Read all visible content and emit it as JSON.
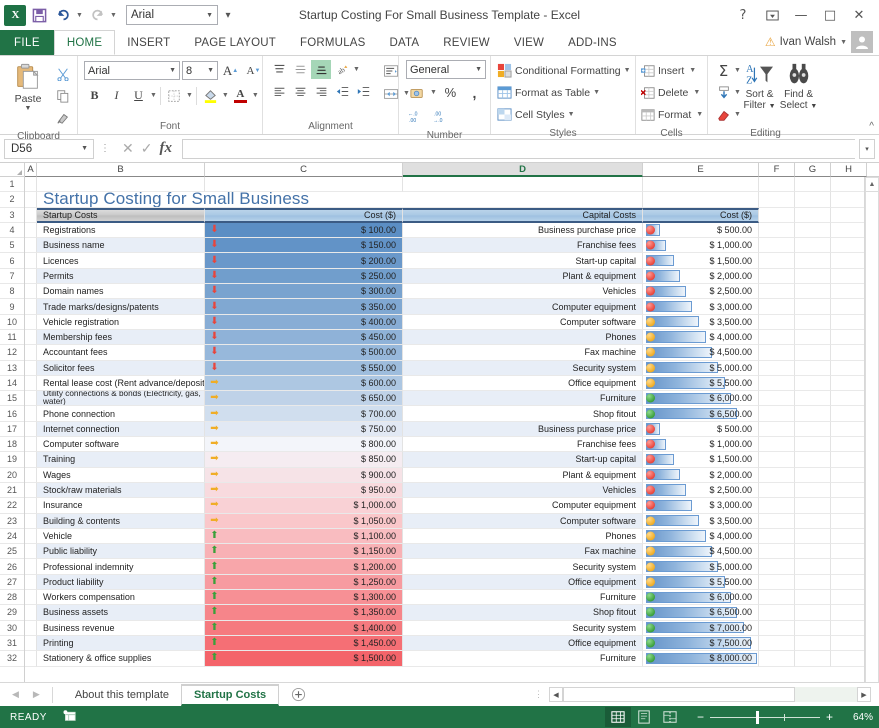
{
  "window": {
    "title": "Startup Costing For Small Business Template - Excel",
    "help_icon": "?",
    "ribbon_display_icon": "ribbon-options",
    "minimize_icon": "—",
    "maximize_icon": "□",
    "close_icon": "✕"
  },
  "quick_access": {
    "app_icon": "excel-logo",
    "save_label": "save-icon",
    "undo_label": "undo-icon",
    "redo_label": "redo-icon",
    "font_name": "Arial",
    "more_label": "more-commands"
  },
  "account": {
    "warning_icon": "warning-triangle",
    "user_name": "Ivan Walsh",
    "avatar_icon": "user-avatar"
  },
  "tabs": {
    "file": "FILE",
    "items": [
      {
        "label": "HOME",
        "active": true
      },
      {
        "label": "INSERT",
        "active": false
      },
      {
        "label": "PAGE LAYOUT",
        "active": false
      },
      {
        "label": "FORMULAS",
        "active": false
      },
      {
        "label": "DATA",
        "active": false
      },
      {
        "label": "REVIEW",
        "active": false
      },
      {
        "label": "VIEW",
        "active": false
      },
      {
        "label": "ADD-INS",
        "active": false
      }
    ]
  },
  "ribbon": {
    "clipboard": {
      "group_label": "Clipboard",
      "paste_label": "Paste",
      "cut_label": "cut-icon",
      "copy_label": "copy-icon",
      "format_painter_label": "format-painter-icon",
      "dialog_launcher": "▪"
    },
    "font": {
      "group_label": "Font",
      "font_name": "Arial",
      "font_size": "8",
      "grow_font": "A",
      "shrink_font": "A",
      "bold": "B",
      "italic": "I",
      "underline": "U",
      "borders": "borders-icon",
      "fill_color": "fill-color-icon",
      "font_color": "A",
      "dialog_launcher": "▪"
    },
    "alignment": {
      "group_label": "Alignment",
      "top_align": "top-align-icon",
      "middle_align": "middle-align-icon",
      "bottom_align": "bottom-align-icon",
      "orientation": "orientation-icon",
      "align_left": "align-left-icon",
      "align_center": "align-center-icon",
      "align_right": "align-right-icon",
      "decrease_indent": "decrease-indent-icon",
      "increase_indent": "increase-indent-icon",
      "wrap_text": "wrap-text-icon",
      "merge_center": "merge-center-icon",
      "dialog_launcher": "▪"
    },
    "number": {
      "group_label": "Number",
      "format": "General",
      "accounting": "accounting-format-icon",
      "percent": "%",
      "comma": ",",
      "increase_decimal": ".00",
      "decrease_decimal": ".00",
      "dialog_launcher": "▪"
    },
    "styles": {
      "group_label": "Styles",
      "conditional_formatting": "Conditional Formatting",
      "format_as_table": "Format as Table",
      "cell_styles": "Cell Styles"
    },
    "cells": {
      "group_label": "Cells",
      "insert": "Insert",
      "delete": "Delete",
      "format": "Format"
    },
    "editing": {
      "group_label": "Editing",
      "autosum": "Σ",
      "fill": "fill-icon",
      "clear": "clear-icon",
      "sort_filter": "Sort &\nFilter",
      "sort_filter_l1": "Sort &",
      "sort_filter_l2": "Filter",
      "find_select_l1": "Find &",
      "find_select_l2": "Select"
    },
    "collapse_icon": "^"
  },
  "formula_bar": {
    "name_box": "D56",
    "cancel_icon": "✕",
    "enter_icon": "✓",
    "function_icon": "fx",
    "formula_value": "",
    "expand_icon": "▾"
  },
  "grid": {
    "columns": [
      "A",
      "B",
      "C",
      "D",
      "E",
      "F",
      "G",
      "H"
    ],
    "selected_column": "D",
    "row_numbers": [
      1,
      2,
      3,
      4,
      5,
      6,
      7,
      8,
      9,
      10,
      11,
      12,
      13,
      14,
      15,
      16,
      17,
      18,
      19,
      20,
      21,
      22,
      23,
      24,
      25,
      26,
      27,
      28,
      29,
      30,
      31,
      32
    ],
    "sheet_title": "Startup Costing for Small Business",
    "headers": {
      "startup_costs": "Startup Costs",
      "cost_left": "Cost ($)",
      "capital_costs": "Capital Costs",
      "cost_right": "Cost ($)"
    }
  },
  "chart_data": {
    "type": "table",
    "title": "Startup Costing for Small Business",
    "startup_costs": {
      "columns": [
        "Startup Costs",
        "Cost ($)"
      ],
      "rows": [
        {
          "row": 4,
          "label": "Registrations",
          "value": "$ 100.00",
          "amount": 100,
          "icon": "red-down-arrow"
        },
        {
          "row": 5,
          "label": "Business name",
          "value": "$ 150.00",
          "amount": 150,
          "icon": "red-down-arrow"
        },
        {
          "row": 6,
          "label": "Licences",
          "value": "$ 200.00",
          "amount": 200,
          "icon": "red-down-arrow"
        },
        {
          "row": 7,
          "label": "Permits",
          "value": "$ 250.00",
          "amount": 250,
          "icon": "red-down-arrow"
        },
        {
          "row": 8,
          "label": "Domain names",
          "value": "$ 300.00",
          "amount": 300,
          "icon": "red-down-arrow"
        },
        {
          "row": 9,
          "label": "Trade marks/designs/patents",
          "value": "$ 350.00",
          "amount": 350,
          "icon": "red-down-arrow"
        },
        {
          "row": 10,
          "label": "Vehicle registration",
          "value": "$ 400.00",
          "amount": 400,
          "icon": "red-down-arrow"
        },
        {
          "row": 11,
          "label": "Membership fees",
          "value": "$ 450.00",
          "amount": 450,
          "icon": "red-down-arrow"
        },
        {
          "row": 12,
          "label": "Accountant fees",
          "value": "$ 500.00",
          "amount": 500,
          "icon": "red-down-arrow"
        },
        {
          "row": 13,
          "label": "Solicitor fees",
          "value": "$ 550.00",
          "amount": 550,
          "icon": "red-down-arrow"
        },
        {
          "row": 14,
          "label": "Rental lease cost (Rent advance/deposit)",
          "value": "$ 600.00",
          "amount": 600,
          "icon": "yellow-right-arrow"
        },
        {
          "row": 15,
          "label": "Utility connections & bonds (Electricity, gas, water)",
          "value": "$ 650.00",
          "amount": 650,
          "icon": "yellow-right-arrow"
        },
        {
          "row": 16,
          "label": "Phone connection",
          "value": "$ 700.00",
          "amount": 700,
          "icon": "yellow-right-arrow"
        },
        {
          "row": 17,
          "label": "Internet connection",
          "value": "$ 750.00",
          "amount": 750,
          "icon": "yellow-right-arrow"
        },
        {
          "row": 18,
          "label": "Computer software",
          "value": "$ 800.00",
          "amount": 800,
          "icon": "yellow-right-arrow"
        },
        {
          "row": 19,
          "label": "Training",
          "value": "$ 850.00",
          "amount": 850,
          "icon": "yellow-right-arrow"
        },
        {
          "row": 20,
          "label": "Wages",
          "value": "$ 900.00",
          "amount": 900,
          "icon": "yellow-right-arrow"
        },
        {
          "row": 21,
          "label": "Stock/raw materials",
          "value": "$ 950.00",
          "amount": 950,
          "icon": "yellow-right-arrow"
        },
        {
          "row": 22,
          "label": "Insurance",
          "value": "$ 1,000.00",
          "amount": 1000,
          "icon": "yellow-right-arrow"
        },
        {
          "row": 23,
          "label": "Building & contents",
          "value": "$ 1,050.00",
          "amount": 1050,
          "icon": "yellow-right-arrow"
        },
        {
          "row": 24,
          "label": "Vehicle",
          "value": "$ 1,100.00",
          "amount": 1100,
          "icon": "green-up-arrow"
        },
        {
          "row": 25,
          "label": "Public liability",
          "value": "$ 1,150.00",
          "amount": 1150,
          "icon": "green-up-arrow"
        },
        {
          "row": 26,
          "label": "Professional indemnity",
          "value": "$ 1,200.00",
          "amount": 1200,
          "icon": "green-up-arrow"
        },
        {
          "row": 27,
          "label": "Product liability",
          "value": "$ 1,250.00",
          "amount": 1250,
          "icon": "green-up-arrow"
        },
        {
          "row": 28,
          "label": "Workers compensation",
          "value": "$ 1,300.00",
          "amount": 1300,
          "icon": "green-up-arrow"
        },
        {
          "row": 29,
          "label": "Business assets",
          "value": "$ 1,350.00",
          "amount": 1350,
          "icon": "green-up-arrow"
        },
        {
          "row": 30,
          "label": "Business revenue",
          "value": "$ 1,400.00",
          "amount": 1400,
          "icon": "green-up-arrow"
        },
        {
          "row": 31,
          "label": "Printing",
          "value": "$ 1,450.00",
          "amount": 1450,
          "icon": "green-up-arrow"
        },
        {
          "row": 32,
          "label": "Stationery & office supplies",
          "value": "$ 1,500.00",
          "amount": 1500,
          "icon": "green-up-arrow"
        }
      ]
    },
    "capital_costs": {
      "columns": [
        "Capital Costs",
        "Cost ($)"
      ],
      "rows": [
        {
          "row": 4,
          "label": "Business purchase price",
          "value": "$ 500.00",
          "amount": 500,
          "icon": "red-circle",
          "bar_pct": 6
        },
        {
          "row": 5,
          "label": "Franchise fees",
          "value": "$ 1,000.00",
          "amount": 1000,
          "icon": "red-circle",
          "bar_pct": 12
        },
        {
          "row": 6,
          "label": "Start-up capital",
          "value": "$ 1,500.00",
          "amount": 1500,
          "icon": "red-circle",
          "bar_pct": 19
        },
        {
          "row": 7,
          "label": "Plant & equipment",
          "value": "$ 2,000.00",
          "amount": 2000,
          "icon": "red-circle",
          "bar_pct": 25
        },
        {
          "row": 8,
          "label": "Vehicles",
          "value": "$ 2,500.00",
          "amount": 2500,
          "icon": "red-circle",
          "bar_pct": 31
        },
        {
          "row": 9,
          "label": "Computer equipment",
          "value": "$ 3,000.00",
          "amount": 3000,
          "icon": "red-circle",
          "bar_pct": 37
        },
        {
          "row": 10,
          "label": "Computer software",
          "value": "$ 3,500.00",
          "amount": 3500,
          "icon": "yellow-circle",
          "bar_pct": 44
        },
        {
          "row": 11,
          "label": "Phones",
          "value": "$ 4,000.00",
          "amount": 4000,
          "icon": "yellow-circle",
          "bar_pct": 50
        },
        {
          "row": 12,
          "label": "Fax machine",
          "value": "$ 4,500.00",
          "amount": 4500,
          "icon": "yellow-circle",
          "bar_pct": 56
        },
        {
          "row": 13,
          "label": "Security system",
          "value": "$ 5,000.00",
          "amount": 5000,
          "icon": "yellow-circle",
          "bar_pct": 62
        },
        {
          "row": 14,
          "label": "Office equipment",
          "value": "$ 5,500.00",
          "amount": 5500,
          "icon": "yellow-circle",
          "bar_pct": 69
        },
        {
          "row": 15,
          "label": "Furniture",
          "value": "$ 6,000.00",
          "amount": 6000,
          "icon": "green-circle",
          "bar_pct": 75
        },
        {
          "row": 16,
          "label": "Shop fitout",
          "value": "$ 6,500.00",
          "amount": 6500,
          "icon": "green-circle",
          "bar_pct": 81
        },
        {
          "row": 17,
          "label": "Business purchase price",
          "value": "$ 500.00",
          "amount": 500,
          "icon": "red-circle",
          "bar_pct": 6
        },
        {
          "row": 18,
          "label": "Franchise fees",
          "value": "$ 1,000.00",
          "amount": 1000,
          "icon": "red-circle",
          "bar_pct": 12
        },
        {
          "row": 19,
          "label": "Start-up capital",
          "value": "$ 1,500.00",
          "amount": 1500,
          "icon": "red-circle",
          "bar_pct": 19
        },
        {
          "row": 20,
          "label": "Plant & equipment",
          "value": "$ 2,000.00",
          "amount": 2000,
          "icon": "red-circle",
          "bar_pct": 25
        },
        {
          "row": 21,
          "label": "Vehicles",
          "value": "$ 2,500.00",
          "amount": 2500,
          "icon": "red-circle",
          "bar_pct": 31
        },
        {
          "row": 22,
          "label": "Computer equipment",
          "value": "$ 3,000.00",
          "amount": 3000,
          "icon": "red-circle",
          "bar_pct": 37
        },
        {
          "row": 23,
          "label": "Computer software",
          "value": "$ 3,500.00",
          "amount": 3500,
          "icon": "yellow-circle",
          "bar_pct": 44
        },
        {
          "row": 24,
          "label": "Phones",
          "value": "$ 4,000.00",
          "amount": 4000,
          "icon": "yellow-circle",
          "bar_pct": 50
        },
        {
          "row": 25,
          "label": "Fax machine",
          "value": "$ 4,500.00",
          "amount": 4500,
          "icon": "yellow-circle",
          "bar_pct": 56
        },
        {
          "row": 26,
          "label": "Security system",
          "value": "$ 5,000.00",
          "amount": 5000,
          "icon": "yellow-circle",
          "bar_pct": 62
        },
        {
          "row": 27,
          "label": "Office equipment",
          "value": "$ 5,500.00",
          "amount": 5500,
          "icon": "yellow-circle",
          "bar_pct": 69
        },
        {
          "row": 28,
          "label": "Furniture",
          "value": "$ 6,000.00",
          "amount": 6000,
          "icon": "green-circle",
          "bar_pct": 75
        },
        {
          "row": 29,
          "label": "Shop fitout",
          "value": "$ 6,500.00",
          "amount": 6500,
          "icon": "green-circle",
          "bar_pct": 81
        },
        {
          "row": 30,
          "label": "Security system",
          "value": "$ 7,000.00",
          "amount": 7000,
          "icon": "green-circle",
          "bar_pct": 87
        },
        {
          "row": 31,
          "label": "Office equipment",
          "value": "$ 7,500.00",
          "amount": 7500,
          "icon": "green-circle",
          "bar_pct": 94
        },
        {
          "row": 32,
          "label": "Furniture",
          "value": "$ 8,000.00",
          "amount": 8000,
          "icon": "green-circle",
          "bar_pct": 100
        }
      ]
    },
    "colors": {
      "title_text": "#4472a8",
      "header_blue": "#a9c8e4",
      "header_gray": "#c9c9c9",
      "scale_low_blue": "#5b8ec4",
      "scale_high_red": "#f4646a",
      "alt_row": "#e8eef7",
      "bar_blue": "#6694c9",
      "icon_red": "#e8453c",
      "icon_yellow": "#f0ad25",
      "icon_green": "#3aa03a",
      "accent_green": "#217346"
    }
  },
  "sheet_tabs": {
    "prev_icon": "◀",
    "next_icon": "▶",
    "items": [
      {
        "label": "About this template",
        "active": false
      },
      {
        "label": "Startup Costs",
        "active": true
      }
    ],
    "add_icon": "+"
  },
  "status_bar": {
    "mode": "READY",
    "macro_icon": "record-macro-icon",
    "view_normal": "normal-view-icon",
    "view_page_layout": "page-layout-view-icon",
    "view_page_break": "page-break-view-icon",
    "zoom_out": "−",
    "zoom_in": "+",
    "zoom_level": "64%"
  }
}
